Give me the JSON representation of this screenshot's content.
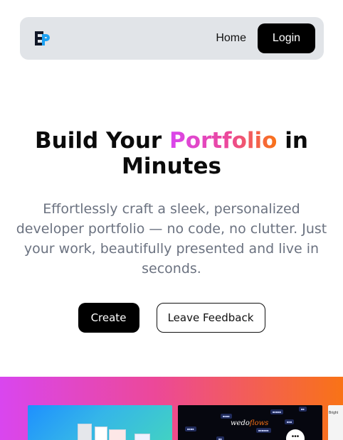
{
  "navbar": {
    "logo_text": "EP",
    "links": [
      {
        "label": "Home"
      }
    ],
    "login_label": "Login"
  },
  "hero": {
    "title_before": "Build Your ",
    "title_highlight": "Portfolio",
    "title_after": " in Minutes",
    "subtitle": "Effortlessly craft a sleek, personalized developer portfolio — no code, no clutter. Just your work, beautifully presented and live in seconds.",
    "create_label": "Create",
    "feedback_label": "Leave Feedback"
  },
  "showcase": {
    "items": [
      {
        "name": "template-preview-1"
      },
      {
        "name": "template-preview-2",
        "brand": "wedo",
        "brand_accent": "flows",
        "bubble": "•••"
      },
      {
        "name": "template-preview-3",
        "snippet": "Bright"
      }
    ]
  },
  "colors": {
    "nav_bg": "#e1e4e8",
    "primary": "#000000",
    "gradient_start": "#d946ef",
    "gradient_mid": "#ec4899",
    "gradient_end": "#f97316",
    "subtitle": "#6b7280"
  },
  "icons": {
    "logo": "ep-logo-icon"
  }
}
